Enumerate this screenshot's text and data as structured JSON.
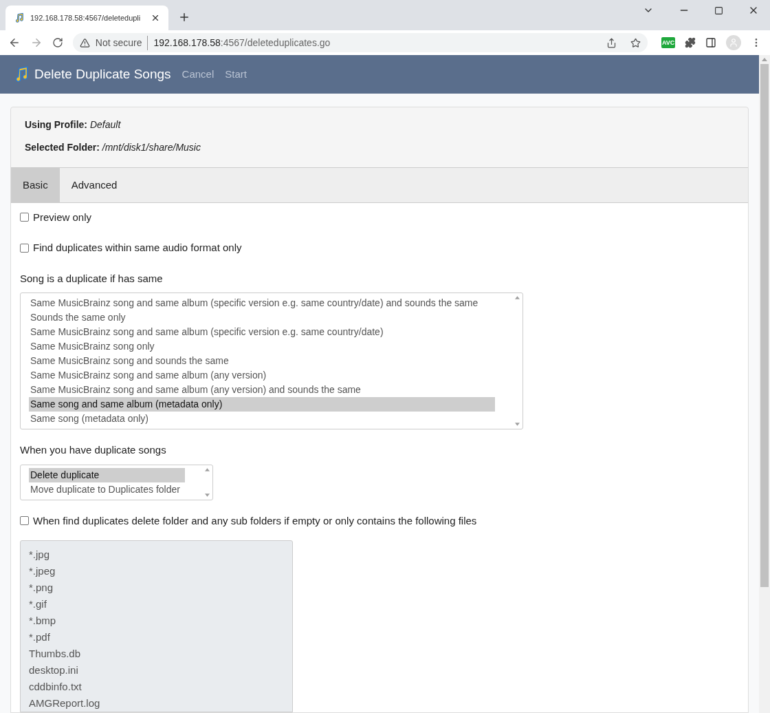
{
  "browser": {
    "tab_title": "192.168.178.58:4567/deletedupli",
    "security": "Not secure",
    "url_host": "192.168.178.58",
    "url_rest": ":4567/deleteduplicates.go",
    "extension_badge": "AVC"
  },
  "header": {
    "title": "Delete Duplicate Songs",
    "nav": [
      "Cancel",
      "Start"
    ]
  },
  "info": [
    {
      "label": "Using Profile:",
      "value": "Default"
    },
    {
      "label": "Selected Folder:",
      "value": "/mnt/disk1/share/Music"
    }
  ],
  "tabs": [
    {
      "label": "Basic",
      "selected": true
    },
    {
      "label": "Advanced",
      "selected": false
    }
  ],
  "options": [
    {
      "label": "Preview only",
      "checked": false
    },
    {
      "label": "Find duplicates within same audio format only",
      "checked": false
    }
  ],
  "duplicate_rule": {
    "label": "Song is a duplicate if has same",
    "items": [
      {
        "label": "Same MusicBrainz song and same album (specific version e.g. same country/date) and sounds the same",
        "selected": false
      },
      {
        "label": "Sounds the same only",
        "selected": false
      },
      {
        "label": "Same MusicBrainz song and same album (specific version e.g. same country/date)",
        "selected": false
      },
      {
        "label": "Same MusicBrainz song only",
        "selected": false
      },
      {
        "label": "Same MusicBrainz song and sounds the same",
        "selected": false
      },
      {
        "label": "Same MusicBrainz song and same album (any version)",
        "selected": false
      },
      {
        "label": "Same MusicBrainz song and same album (any version) and sounds the same",
        "selected": false
      },
      {
        "label": "Same song and same album (metadata only)",
        "selected": true
      },
      {
        "label": "Same song (metadata only)",
        "selected": false
      }
    ]
  },
  "action": {
    "label": "When you have duplicate songs",
    "items": [
      {
        "label": "Delete duplicate",
        "selected": true
      },
      {
        "label": "Move duplicate to Duplicates folder",
        "selected": false
      }
    ]
  },
  "delete_folder": {
    "label": "When find duplicates delete folder and any sub folders if empty or only contains the following files",
    "checked": false,
    "files": [
      "*.jpg",
      "*.jpeg",
      "*.png",
      "*.gif",
      "*.bmp",
      "*.pdf",
      "Thumbs.db",
      "desktop.ini",
      "cddbinfo.txt",
      "AMGReport.log"
    ]
  }
}
